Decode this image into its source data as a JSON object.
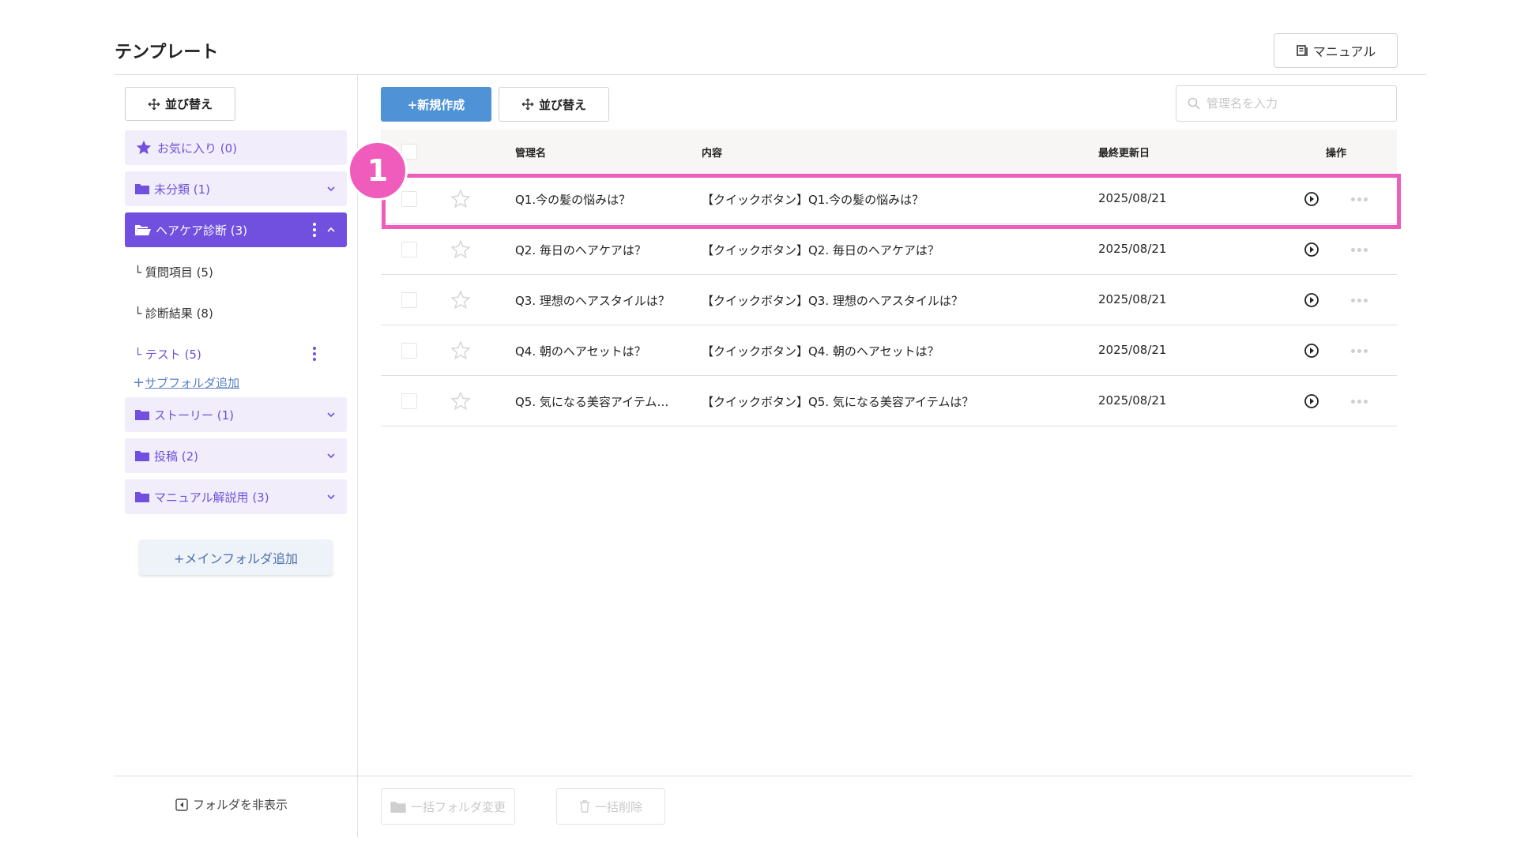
{
  "header": {
    "title": "テンプレート",
    "manual_label": "マニュアル"
  },
  "sidebar": {
    "sort_label": "並び替え",
    "favorites": {
      "label": "お気に入り (0)"
    },
    "folders": [
      {
        "label": "未分類 (1)"
      },
      {
        "label": "ヘアケア診断 (3)"
      },
      {
        "label": "ストーリー (1)"
      },
      {
        "label": "投稿 (2)"
      },
      {
        "label": "マニュアル解説用 (3)"
      }
    ],
    "subfolders": [
      {
        "label": "質問項目 (5)"
      },
      {
        "label": "診断結果 (8)"
      },
      {
        "label": "テスト (5)"
      }
    ],
    "add_subfolder_label": "サブフォルダ追加",
    "add_main_folder_label": "+メインフォルダ追加",
    "hide_folder_label": "フォルダを非表示"
  },
  "toolbar": {
    "new_label": "+新規作成",
    "sort_label": "並び替え",
    "search_placeholder": "管理名を入力"
  },
  "table": {
    "headers": {
      "name": "管理名",
      "content": "内容",
      "updated": "最終更新日",
      "actions": "操作"
    },
    "rows": [
      {
        "name": "Q1.今の髪の悩みは？",
        "content": "【クイックボタン】Q1.今の髪の悩みは？",
        "updated": "2025/08/21"
      },
      {
        "name": "Q2. 毎日のヘアケアは？",
        "content": "【クイックボタン】Q2. 毎日のヘアケアは？",
        "updated": "2025/08/21"
      },
      {
        "name": "Q3. 理想のヘアスタイルは？",
        "content": "【クイックボタン】Q3. 理想のヘアスタイルは？",
        "updated": "2025/08/21"
      },
      {
        "name": "Q4. 朝のヘアセットは？",
        "content": "【クイックボタン】Q4. 朝のヘアセットは？",
        "updated": "2025/08/21"
      },
      {
        "name": "Q5. 気になる美容アイテム…",
        "content": "【クイックボタン】Q5. 気になる美容アイテムは？",
        "updated": "2025/08/21"
      }
    ]
  },
  "bulk": {
    "folder_change_label": "一括フォルダ変更",
    "delete_label": "一括削除"
  },
  "annotation": {
    "step_number": "1"
  },
  "colors": {
    "accent_purple": "#7150e0",
    "primary_blue": "#4f93d6",
    "highlight_pink": "#ec5dbd"
  }
}
